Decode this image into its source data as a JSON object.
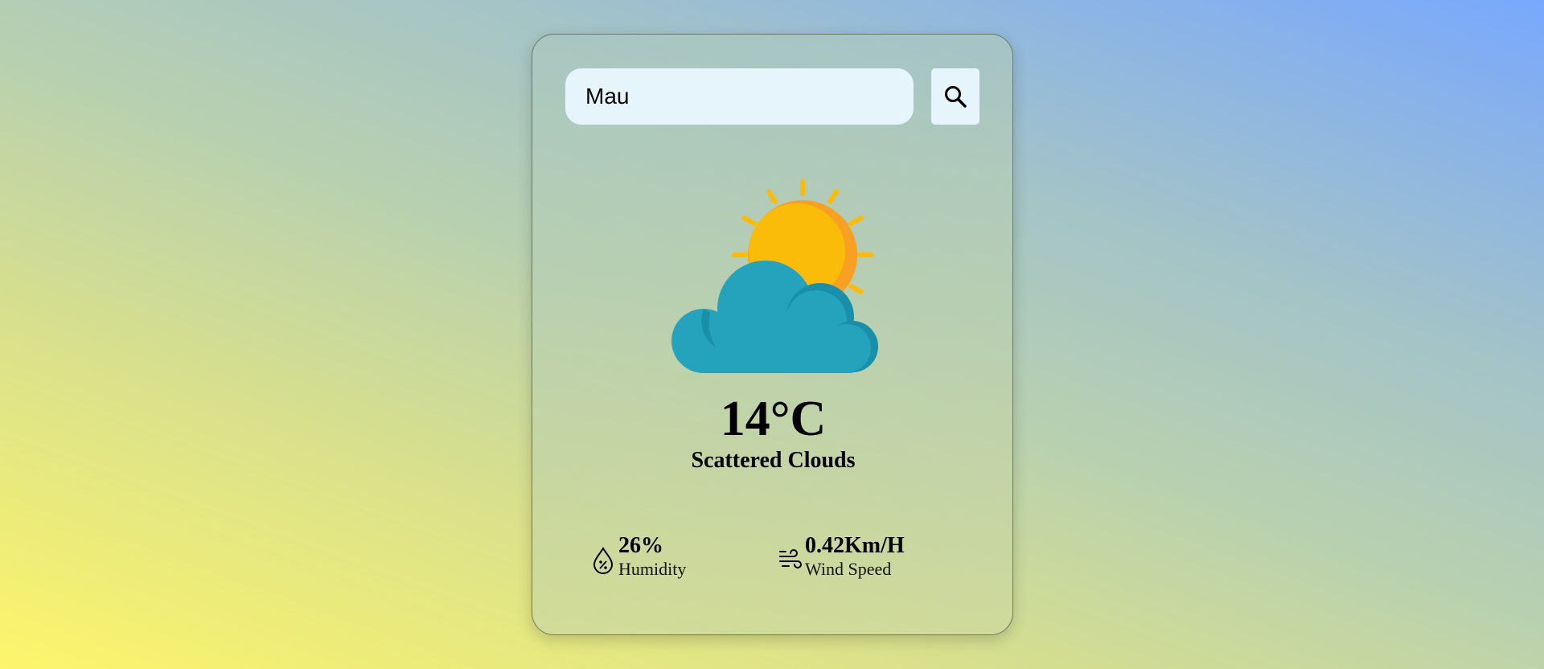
{
  "search": {
    "value": "Mau",
    "placeholder": ""
  },
  "search_button": {
    "icon": "search-icon"
  },
  "weather": {
    "icon": "sun-behind-cloud-icon",
    "temperature": "14°C",
    "condition": "Scattered Clouds"
  },
  "stats": {
    "humidity": {
      "icon": "humidity-drop-icon",
      "value": "26%",
      "label": "Humidity"
    },
    "wind": {
      "icon": "wind-icon",
      "value": "0.42Km/H",
      "label": "Wind Speed"
    }
  },
  "colors": {
    "sun": "#FBBC09",
    "sun_shadow": "#F7A021",
    "cloud": "#26A3BC",
    "cloud_shadow": "#1A8FAA",
    "input_bg": "#E6F4FC"
  }
}
